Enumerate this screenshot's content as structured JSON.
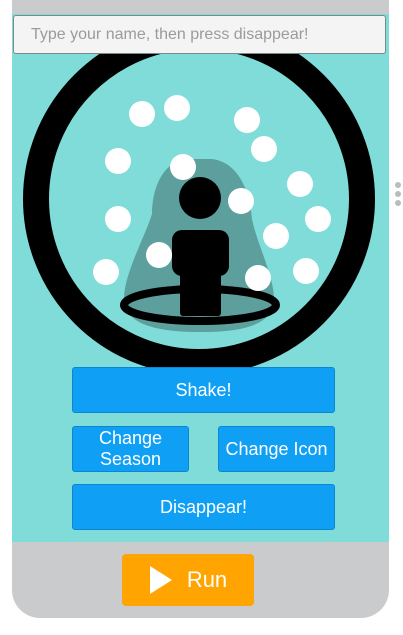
{
  "name_input": {
    "placeholder": "Type your name, then press disappear!",
    "value": ""
  },
  "buttons": {
    "shake": "Shake!",
    "change_season": "Change Season",
    "change_icon": "Change Icon",
    "disappear": "Disappear!"
  },
  "run_button": {
    "label": "Run",
    "icon": "play-icon"
  },
  "colors": {
    "app_background": "#7fdcd8",
    "button_blue": "#0fa0f6",
    "run_orange": "#ffa400",
    "frame_gray": "#c9cbcd"
  },
  "snow_globe": {
    "icon": "person-icon",
    "snowflake_count": 15
  }
}
